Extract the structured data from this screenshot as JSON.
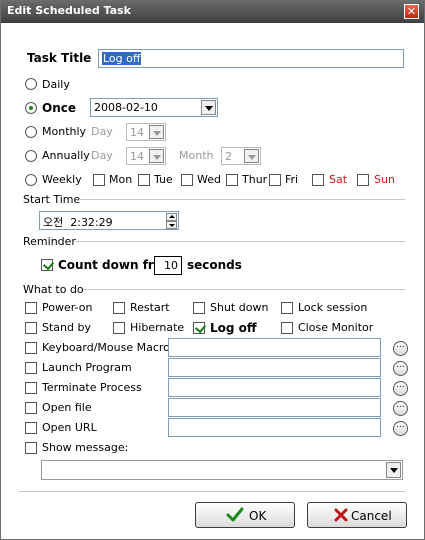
{
  "window": {
    "title": "Edit Scheduled Task",
    "close_icon": "close-icon"
  },
  "task_title": {
    "label": "Task Title",
    "value": "Log off"
  },
  "schedule": {
    "daily": "Daily",
    "once": "Once",
    "once_date": "2008-02-10",
    "monthly": "Monthly",
    "monthly_day_label": "Day",
    "monthly_day": "14",
    "annually": "Annually",
    "annually_day_label": "Day",
    "annually_day": "14",
    "annually_month_label": "Month",
    "annually_month": "2",
    "weekly": "Weekly",
    "days": {
      "mon": "Mon",
      "tue": "Tue",
      "wed": "Wed",
      "thu": "Thur",
      "fri": "Fri",
      "sat": "Sat",
      "sun": "Sun"
    },
    "selected": "once"
  },
  "start_time": {
    "label": "Start Time",
    "value": "오전  2:32:29"
  },
  "reminder": {
    "label": "Reminder",
    "countdown_label": "Count down from",
    "countdown_value": "10",
    "seconds": "seconds",
    "checked": true
  },
  "what_to_do": {
    "label": "What to do",
    "power_on": "Power-on",
    "restart": "Restart",
    "shut_down": "Shut down",
    "lock_session": "Lock session",
    "stand_by": "Stand by",
    "hibernate": "Hibernate",
    "log_off": "Log off",
    "close_monitor": "Close Monitor",
    "keyboard_macro": "Keyboard/Mouse Macro",
    "launch_program": "Launch Program",
    "terminate_process": "Terminate Process",
    "open_file": "Open file",
    "open_url": "Open URL",
    "show_message": "Show message:",
    "selected": "log_off"
  },
  "buttons": {
    "ok": "OK",
    "cancel": "Cancel"
  },
  "colors": {
    "titlebar": "#4f4f4f",
    "weekend": "#d21616",
    "ok_check": "#1a8a1a",
    "cancel_x": "#c0141a"
  }
}
